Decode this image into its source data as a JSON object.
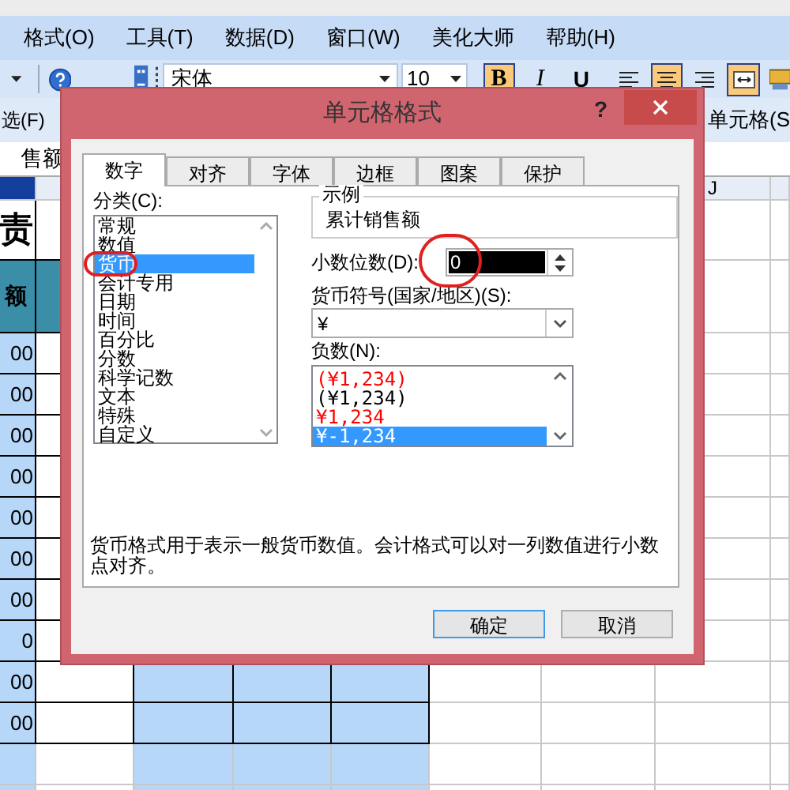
{
  "menu_bar": [
    {
      "label": "格式(O)"
    },
    {
      "label": "工具(T)"
    },
    {
      "label": "数据(D)"
    },
    {
      "label": "窗口(W)"
    },
    {
      "label": "美化大师"
    },
    {
      "label": "帮助(H)"
    }
  ],
  "toolbar": {
    "font": "宋体",
    "size": "10",
    "buttons": [
      {
        "kind": "bold",
        "label": "B",
        "selected": true
      },
      {
        "kind": "italic",
        "label": "I",
        "selected": false
      },
      {
        "kind": "underline",
        "label": "U",
        "selected": false
      },
      {
        "kind": "align-left",
        "selected": false
      },
      {
        "kind": "align-center",
        "selected": true
      },
      {
        "kind": "align-right",
        "selected": false
      },
      {
        "kind": "merge",
        "selected": true
      }
    ]
  },
  "toolbar_2": {
    "left": "选(F)",
    "right": "单元格(S"
  },
  "formula_bar": {
    "value": "售额"
  },
  "sheet": {
    "column_header": "J",
    "title_cell": "责",
    "header_cell": "额",
    "column_a": [
      "00",
      "00",
      "00",
      "00",
      "00",
      "00",
      "00",
      "0",
      "00",
      "00"
    ]
  },
  "dialog": {
    "title": "单元格格式",
    "help": "?",
    "tabs": [
      {
        "label": "数字",
        "selected": true
      },
      {
        "label": "对齐",
        "selected": false
      },
      {
        "label": "字体",
        "selected": false
      },
      {
        "label": "边框",
        "selected": false
      },
      {
        "label": "图案",
        "selected": false
      },
      {
        "label": "保护",
        "selected": false
      }
    ],
    "category_label": "分类(C):",
    "categories": [
      {
        "label": "常规",
        "selected": false,
        "circled": false
      },
      {
        "label": "数值",
        "selected": false,
        "circled": false
      },
      {
        "label": "货币",
        "selected": true,
        "circled": true
      },
      {
        "label": "会计专用",
        "selected": false,
        "circled": false
      },
      {
        "label": "日期",
        "selected": false,
        "circled": false
      },
      {
        "label": "时间",
        "selected": false,
        "circled": false
      },
      {
        "label": "百分比",
        "selected": false,
        "circled": false
      },
      {
        "label": "分数",
        "selected": false,
        "circled": false
      },
      {
        "label": "科学记数",
        "selected": false,
        "circled": false
      },
      {
        "label": "文本",
        "selected": false,
        "circled": false
      },
      {
        "label": "特殊",
        "selected": false,
        "circled": false
      },
      {
        "label": "自定义",
        "selected": false,
        "circled": false
      }
    ],
    "sample": {
      "legend": "示例",
      "value": "累计销售额"
    },
    "decimal_places": {
      "label": "小数位数(D):",
      "value": "0",
      "circled": true
    },
    "currency_symbol": {
      "label": "货币符号(国家/地区)(S):",
      "value": "¥"
    },
    "negative_numbers": {
      "label": "负数(N):",
      "items": [
        {
          "label": "(¥1,234)",
          "color": "#ff0000",
          "selected": false
        },
        {
          "label": "(¥1,234)",
          "color": "#000000",
          "selected": false
        },
        {
          "label": "¥1,234",
          "color": "#ff0000",
          "selected": false
        },
        {
          "label": "¥-1,234",
          "selected": true
        }
      ]
    },
    "description": "货币格式用于表示一般货币数值。会计格式可以对一列数值进行小数点对齐。",
    "buttons": [
      {
        "label": "确定",
        "default": true
      },
      {
        "label": "取消",
        "default": false
      }
    ]
  }
}
